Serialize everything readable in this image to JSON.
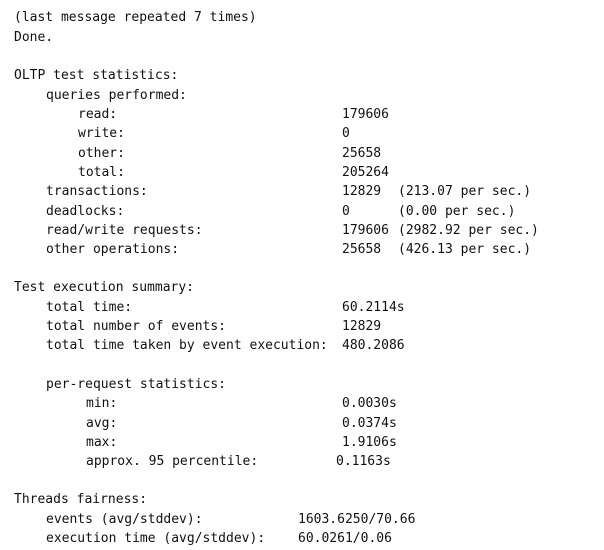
{
  "console": {
    "lines": {
      "repeat_notice": "(last message repeated 7 times)",
      "done": "Done.",
      "oltp_header": "OLTP test statistics:",
      "queries_header": "queries performed:",
      "read_label": "read:",
      "read_value": "179606",
      "write_label": "write:",
      "write_value": "0",
      "other_label": "other:",
      "other_value": "25658",
      "total_label": "total:",
      "total_value": "205264",
      "transactions_label": "transactions:",
      "transactions_value": "12829",
      "transactions_rate": "(213.07 per sec.)",
      "deadlocks_label": "deadlocks:",
      "deadlocks_value": "0",
      "deadlocks_rate": "(0.00 per sec.)",
      "rw_label": "read/write requests:",
      "rw_value": "179606",
      "rw_rate": "(2982.92 per sec.)",
      "otherops_label": "other operations:",
      "otherops_value": "25658",
      "otherops_rate": "(426.13 per sec.)",
      "exec_header": "Test execution summary:",
      "total_time_label": "total time:",
      "total_time_value": "60.2114s",
      "num_events_label": "total number of events:",
      "num_events_value": "12829",
      "event_exec_label": "total time taken by event execution:",
      "event_exec_value": "480.2086",
      "per_request_header": "per-request statistics:",
      "min_label": "min:",
      "min_value": "0.0030s",
      "avg_label": "avg:",
      "avg_value": "0.0374s",
      "max_label": "max:",
      "max_value": "1.9106s",
      "pct95_label": "approx. 95 percentile:",
      "pct95_value": "0.1163s",
      "fairness_header": "Threads fairness:",
      "events_label": "events (avg/stddev):",
      "events_value": "1603.6250/70.66",
      "exec_time_label": "execution time (avg/stddev):",
      "exec_time_value": "60.0261/0.06"
    }
  }
}
